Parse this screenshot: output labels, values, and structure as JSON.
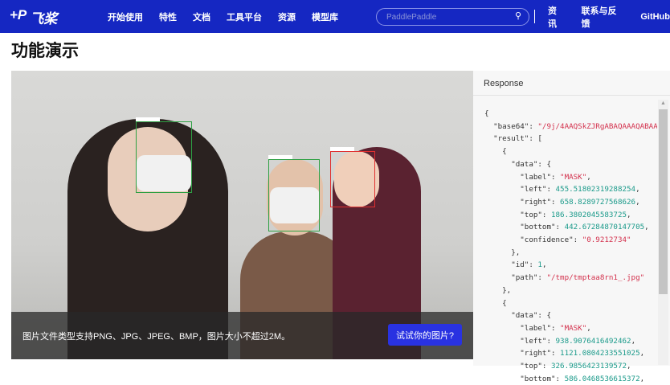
{
  "nav": {
    "logo": "飞桨",
    "menu": [
      "开始使用",
      "特性",
      "文档",
      "工具平台",
      "资源",
      "模型库"
    ],
    "search_placeholder": "PaddlePaddle",
    "right": [
      "资讯",
      "联系与反馈",
      "GitHub"
    ]
  },
  "page_title": "功能演示",
  "demo": {
    "hint": "图片文件类型支持PNG、JPG、JPEG、BMP，图片大小不超过2M。",
    "try_button": "试试你的图片?",
    "box_colors": [
      "#2ea043",
      "#2ea043",
      "#e03030"
    ]
  },
  "response": {
    "title": "Response",
    "json_lines": [
      [
        [
          "{",
          "p"
        ]
      ],
      [
        [
          "  \"base64\": ",
          "p"
        ],
        [
          "\"/9j/4AAQSkZJRgABAQAAAQABAAD",
          "s"
        ]
      ],
      [
        [
          "  \"result\": [",
          "p"
        ]
      ],
      [
        [
          "    {",
          "p"
        ]
      ],
      [
        [
          "      \"data\": {",
          "p"
        ]
      ],
      [
        [
          "        \"label\": ",
          "p"
        ],
        [
          "\"MASK\"",
          "s"
        ],
        [
          ",",
          "p"
        ]
      ],
      [
        [
          "        \"left\": ",
          "p"
        ],
        [
          "455.51802319288254",
          "n"
        ],
        [
          ",",
          "p"
        ]
      ],
      [
        [
          "        \"right\": ",
          "p"
        ],
        [
          "658.8289727568626",
          "n"
        ],
        [
          ",",
          "p"
        ]
      ],
      [
        [
          "        \"top\": ",
          "p"
        ],
        [
          "186.3802045583725",
          "n"
        ],
        [
          ",",
          "p"
        ]
      ],
      [
        [
          "        \"bottom\": ",
          "p"
        ],
        [
          "442.67284870147705",
          "n"
        ],
        [
          ",",
          "p"
        ]
      ],
      [
        [
          "        \"confidence\": ",
          "p"
        ],
        [
          "\"0.9212734\"",
          "s"
        ]
      ],
      [
        [
          "      },",
          "p"
        ]
      ],
      [
        [
          "      \"id\": ",
          "p"
        ],
        [
          "1",
          "n"
        ],
        [
          ",",
          "p"
        ]
      ],
      [
        [
          "      \"path\": ",
          "p"
        ],
        [
          "\"/tmp/tmptaa8rn1_.jpg\"",
          "s"
        ]
      ],
      [
        [
          "    },",
          "p"
        ]
      ],
      [
        [
          "    {",
          "p"
        ]
      ],
      [
        [
          "      \"data\": {",
          "p"
        ]
      ],
      [
        [
          "        \"label\": ",
          "p"
        ],
        [
          "\"MASK\"",
          "s"
        ],
        [
          ",",
          "p"
        ]
      ],
      [
        [
          "        \"left\": ",
          "p"
        ],
        [
          "938.9076416492462",
          "n"
        ],
        [
          ",",
          "p"
        ]
      ],
      [
        [
          "        \"right\": ",
          "p"
        ],
        [
          "1121.0804233551025",
          "n"
        ],
        [
          ",",
          "p"
        ]
      ],
      [
        [
          "        \"top\": ",
          "p"
        ],
        [
          "326.9856423139572",
          "n"
        ],
        [
          ",",
          "p"
        ]
      ],
      [
        [
          "        \"bottom\": ",
          "p"
        ],
        [
          "586.0468536615372",
          "n"
        ],
        [
          ",",
          "p"
        ]
      ]
    ]
  }
}
